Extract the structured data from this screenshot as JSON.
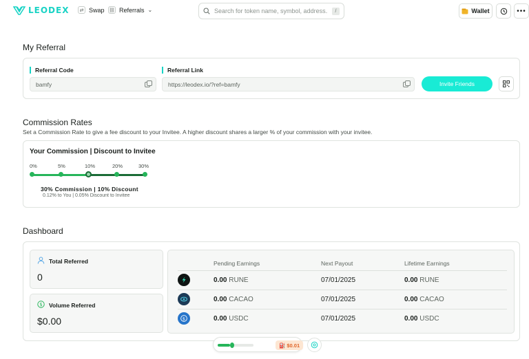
{
  "header": {
    "logo_text": "LEODEX",
    "nav": [
      {
        "label": "Swap",
        "icon": "swap-icon"
      },
      {
        "label": "Referrals",
        "icon": "referrals-icon"
      }
    ],
    "search_placeholder": "Search for token name, symbol, address...",
    "search_shortcut": "/",
    "wallet_label": "Wallet"
  },
  "referral": {
    "title": "My Referral",
    "code_label": "Referral Code",
    "code_value": "bamfy",
    "link_label": "Referral Link",
    "link_value": "https://leodex.io/?ref=bamfy",
    "invite_label": "Invite Friends"
  },
  "commission": {
    "title": "Commission Rates",
    "subtitle": "Set a Commission Rate to give a fee discount to your Invitee. A higher discount shares a larger % of your commission with your invitee.",
    "card_title": "Your Commission | Discount to Invitee",
    "ticks": [
      "0%",
      "5%",
      "10%",
      "20%",
      "30%"
    ],
    "selected_index": 2,
    "summary": "30% Commission | 10% Discount",
    "detail": "0.12% to You | 0.05% Discount to Invitee"
  },
  "dashboard": {
    "title": "Dashboard",
    "total_referred_label": "Total Referred",
    "total_referred_value": "0",
    "volume_referred_label": "Volume Referred",
    "volume_referred_value": "$0.00",
    "columns": [
      "Pending Earnings",
      "Next Payout",
      "Lifetime Earnings"
    ],
    "rows": [
      {
        "coin": "rune",
        "pending": "0.00",
        "pending_unit": "RUNE",
        "next_payout": "07/01/2025",
        "lifetime": "0.00",
        "lifetime_unit": "RUNE"
      },
      {
        "coin": "cacao",
        "pending": "0.00",
        "pending_unit": "CACAO",
        "next_payout": "07/01/2025",
        "lifetime": "0.00",
        "lifetime_unit": "CACAO"
      },
      {
        "coin": "usdc",
        "pending": "0.00",
        "pending_unit": "USDC",
        "next_payout": "07/01/2025",
        "lifetime": "0.00",
        "lifetime_unit": "USDC"
      }
    ]
  },
  "footer": {
    "gas_price": "$0.01"
  },
  "colors": {
    "accent": "#19d3c5",
    "invite_button": "#19ebd5",
    "slider_green": "#26b55a",
    "slider_dark": "#1a6b36",
    "badge_orange": "#e0662a"
  }
}
